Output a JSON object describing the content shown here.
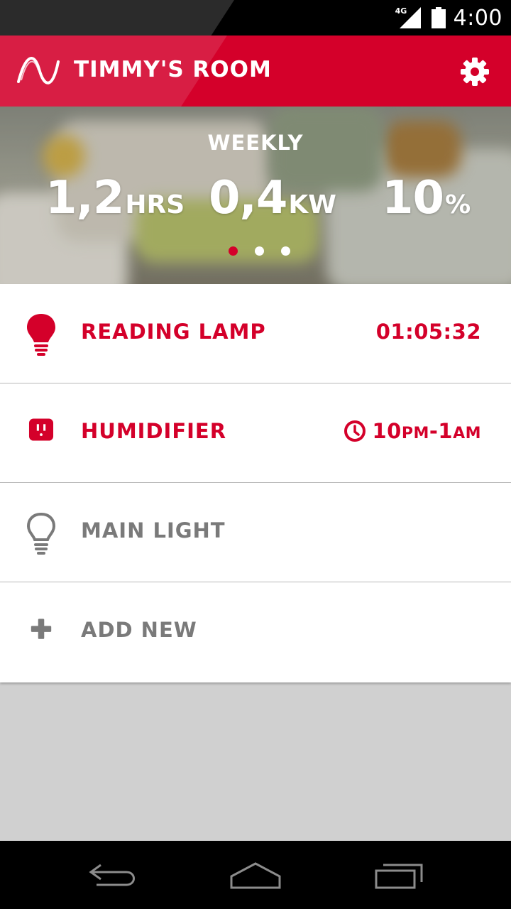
{
  "status_bar": {
    "network": "4G",
    "time": "4:00",
    "icons": [
      "signal-icon",
      "battery-icon"
    ]
  },
  "app_bar": {
    "title": "TIMMY'S ROOM",
    "logo_icon": "wave-logo-icon",
    "settings_icon": "gear-icon"
  },
  "hero": {
    "period_label": "WEEKLY",
    "stats": [
      {
        "value": "1,2",
        "unit": "HRS"
      },
      {
        "value": "0,4",
        "unit": "KW"
      },
      {
        "value": "10",
        "unit": "%"
      }
    ],
    "pager": {
      "pages": 3,
      "active_index": 0
    }
  },
  "devices": [
    {
      "name": "READING LAMP",
      "icon": "lightbulb-filled-icon",
      "status": "01:05:32",
      "state": "on"
    },
    {
      "name": "HUMIDIFIER",
      "icon": "outlet-icon",
      "status_icon": "clock-icon",
      "schedule_start": "10",
      "schedule_start_suffix": "PM",
      "schedule_sep": "-1",
      "schedule_end_suffix": "AM",
      "state": "scheduled"
    },
    {
      "name": "MAIN LIGHT",
      "icon": "lightbulb-outline-icon",
      "state": "off"
    },
    {
      "name": "ADD NEW",
      "icon": "plus-icon",
      "state": "action"
    }
  ],
  "colors": {
    "accent": "#d4002a",
    "inactive": "#7a7a7a",
    "background": "#d0d0d0"
  },
  "nav_bar": {
    "icons": [
      "back-icon",
      "home-icon",
      "recents-icon"
    ]
  }
}
